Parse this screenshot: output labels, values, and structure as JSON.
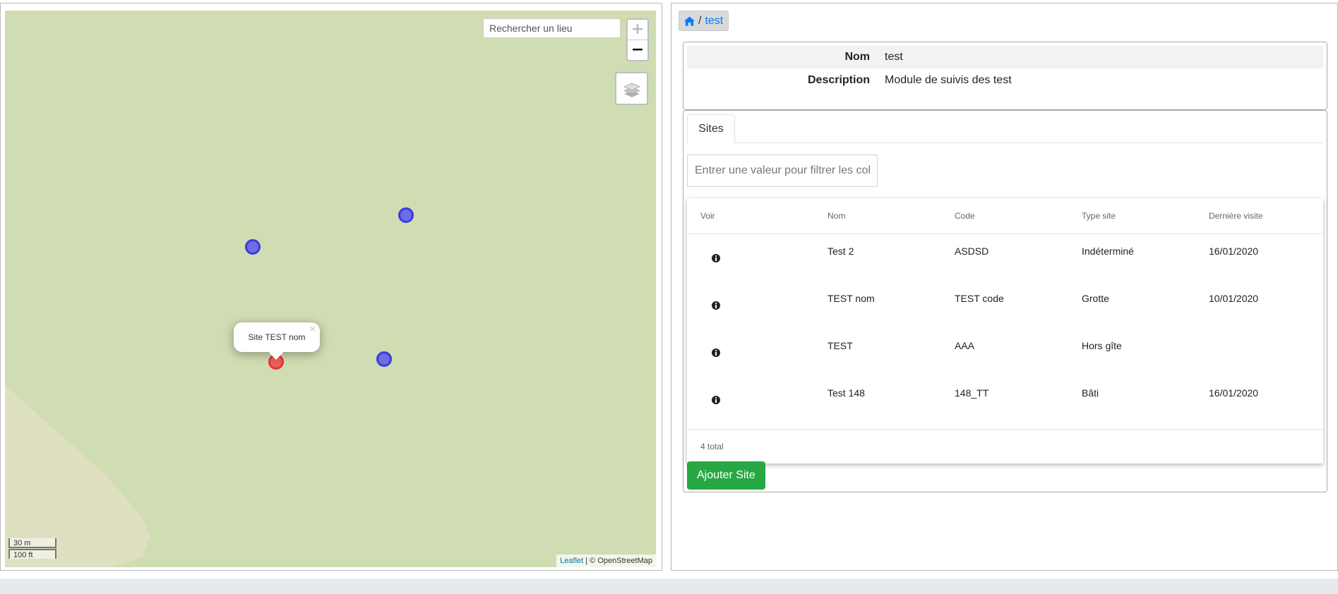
{
  "map": {
    "search_placeholder": "Rechercher un lieu",
    "zoom_in": "+",
    "zoom_out": "−",
    "popup_text": "Site TEST nom",
    "popup_close": "×",
    "scale_metric": "30 m",
    "scale_imperial": "100 ft",
    "attribution_link": "Leaflet",
    "attribution_text": " | © OpenStreetMap",
    "colors": {
      "land": "#d0dcb1",
      "shape": "#dfe0c2",
      "marker_blue": "#3b3be0",
      "marker_red": "#e83434"
    }
  },
  "breadcrumb": {
    "home_icon": "home-icon",
    "separator": "/",
    "current": "test"
  },
  "info": {
    "rows": [
      {
        "key": "Nom",
        "value": "test"
      },
      {
        "key": "Description",
        "value": "Module de suivis des test"
      }
    ]
  },
  "sites": {
    "tab_label": "Sites",
    "filter_placeholder": "Entrer une valeur pour filtrer les colonnes",
    "columns": [
      "Voir",
      "Nom",
      "Code",
      "Type site",
      "Dernière visite"
    ],
    "rows": [
      {
        "nom": "Test 2",
        "code": "ASDSD",
        "type": "Indéterminé",
        "visite": "16/01/2020"
      },
      {
        "nom": "TEST nom",
        "code": "TEST code",
        "type": "Grotte",
        "visite": "10/01/2020"
      },
      {
        "nom": "TEST",
        "code": "AAA",
        "type": "Hors gîte",
        "visite": ""
      },
      {
        "nom": "Test 148",
        "code": "148_TT",
        "type": "Bâti",
        "visite": "16/01/2020"
      }
    ],
    "total": "4 total",
    "add_button": "Ajouter Site",
    "colors": {
      "add_button": "#28a745",
      "link": "#007bff"
    }
  }
}
